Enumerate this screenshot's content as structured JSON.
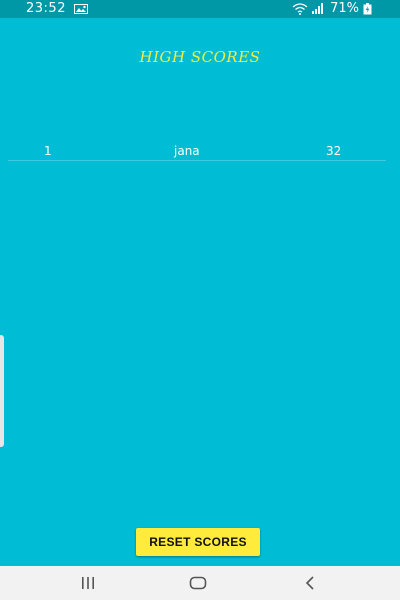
{
  "status_bar": {
    "time": "23:52",
    "battery": "71%",
    "icons": [
      "gallery-icon",
      "wifi-icon",
      "signal-icon",
      "battery-icon"
    ]
  },
  "screen": {
    "title": "HIGH SCORES",
    "title_color": "#f2ee3b",
    "background_color": "#00bcd4",
    "scores": [
      {
        "rank": "1",
        "name": "jana",
        "score": "32"
      }
    ]
  },
  "reset_button": {
    "label": "RESET SCORES",
    "color": "#ffeb3b"
  },
  "nav_bar": {
    "buttons": [
      "recents-icon",
      "home-icon",
      "back-icon"
    ]
  }
}
